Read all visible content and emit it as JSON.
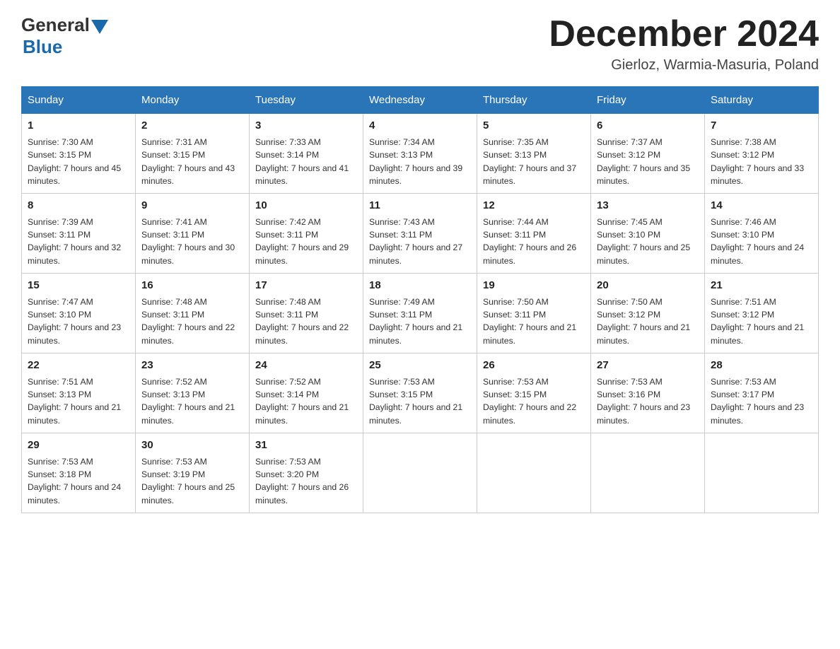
{
  "header": {
    "logo_general": "General",
    "logo_blue": "Blue",
    "month_title": "December 2024",
    "location": "Gierloz, Warmia-Masuria, Poland"
  },
  "days_of_week": [
    "Sunday",
    "Monday",
    "Tuesday",
    "Wednesday",
    "Thursday",
    "Friday",
    "Saturday"
  ],
  "weeks": [
    [
      {
        "day": "1",
        "sunrise": "7:30 AM",
        "sunset": "3:15 PM",
        "daylight": "7 hours and 45 minutes."
      },
      {
        "day": "2",
        "sunrise": "7:31 AM",
        "sunset": "3:15 PM",
        "daylight": "7 hours and 43 minutes."
      },
      {
        "day": "3",
        "sunrise": "7:33 AM",
        "sunset": "3:14 PM",
        "daylight": "7 hours and 41 minutes."
      },
      {
        "day": "4",
        "sunrise": "7:34 AM",
        "sunset": "3:13 PM",
        "daylight": "7 hours and 39 minutes."
      },
      {
        "day": "5",
        "sunrise": "7:35 AM",
        "sunset": "3:13 PM",
        "daylight": "7 hours and 37 minutes."
      },
      {
        "day": "6",
        "sunrise": "7:37 AM",
        "sunset": "3:12 PM",
        "daylight": "7 hours and 35 minutes."
      },
      {
        "day": "7",
        "sunrise": "7:38 AM",
        "sunset": "3:12 PM",
        "daylight": "7 hours and 33 minutes."
      }
    ],
    [
      {
        "day": "8",
        "sunrise": "7:39 AM",
        "sunset": "3:11 PM",
        "daylight": "7 hours and 32 minutes."
      },
      {
        "day": "9",
        "sunrise": "7:41 AM",
        "sunset": "3:11 PM",
        "daylight": "7 hours and 30 minutes."
      },
      {
        "day": "10",
        "sunrise": "7:42 AM",
        "sunset": "3:11 PM",
        "daylight": "7 hours and 29 minutes."
      },
      {
        "day": "11",
        "sunrise": "7:43 AM",
        "sunset": "3:11 PM",
        "daylight": "7 hours and 27 minutes."
      },
      {
        "day": "12",
        "sunrise": "7:44 AM",
        "sunset": "3:11 PM",
        "daylight": "7 hours and 26 minutes."
      },
      {
        "day": "13",
        "sunrise": "7:45 AM",
        "sunset": "3:10 PM",
        "daylight": "7 hours and 25 minutes."
      },
      {
        "day": "14",
        "sunrise": "7:46 AM",
        "sunset": "3:10 PM",
        "daylight": "7 hours and 24 minutes."
      }
    ],
    [
      {
        "day": "15",
        "sunrise": "7:47 AM",
        "sunset": "3:10 PM",
        "daylight": "7 hours and 23 minutes."
      },
      {
        "day": "16",
        "sunrise": "7:48 AM",
        "sunset": "3:11 PM",
        "daylight": "7 hours and 22 minutes."
      },
      {
        "day": "17",
        "sunrise": "7:48 AM",
        "sunset": "3:11 PM",
        "daylight": "7 hours and 22 minutes."
      },
      {
        "day": "18",
        "sunrise": "7:49 AM",
        "sunset": "3:11 PM",
        "daylight": "7 hours and 21 minutes."
      },
      {
        "day": "19",
        "sunrise": "7:50 AM",
        "sunset": "3:11 PM",
        "daylight": "7 hours and 21 minutes."
      },
      {
        "day": "20",
        "sunrise": "7:50 AM",
        "sunset": "3:12 PM",
        "daylight": "7 hours and 21 minutes."
      },
      {
        "day": "21",
        "sunrise": "7:51 AM",
        "sunset": "3:12 PM",
        "daylight": "7 hours and 21 minutes."
      }
    ],
    [
      {
        "day": "22",
        "sunrise": "7:51 AM",
        "sunset": "3:13 PM",
        "daylight": "7 hours and 21 minutes."
      },
      {
        "day": "23",
        "sunrise": "7:52 AM",
        "sunset": "3:13 PM",
        "daylight": "7 hours and 21 minutes."
      },
      {
        "day": "24",
        "sunrise": "7:52 AM",
        "sunset": "3:14 PM",
        "daylight": "7 hours and 21 minutes."
      },
      {
        "day": "25",
        "sunrise": "7:53 AM",
        "sunset": "3:15 PM",
        "daylight": "7 hours and 21 minutes."
      },
      {
        "day": "26",
        "sunrise": "7:53 AM",
        "sunset": "3:15 PM",
        "daylight": "7 hours and 22 minutes."
      },
      {
        "day": "27",
        "sunrise": "7:53 AM",
        "sunset": "3:16 PM",
        "daylight": "7 hours and 23 minutes."
      },
      {
        "day": "28",
        "sunrise": "7:53 AM",
        "sunset": "3:17 PM",
        "daylight": "7 hours and 23 minutes."
      }
    ],
    [
      {
        "day": "29",
        "sunrise": "7:53 AM",
        "sunset": "3:18 PM",
        "daylight": "7 hours and 24 minutes."
      },
      {
        "day": "30",
        "sunrise": "7:53 AM",
        "sunset": "3:19 PM",
        "daylight": "7 hours and 25 minutes."
      },
      {
        "day": "31",
        "sunrise": "7:53 AM",
        "sunset": "3:20 PM",
        "daylight": "7 hours and 26 minutes."
      },
      null,
      null,
      null,
      null
    ]
  ],
  "labels": {
    "sunrise_prefix": "Sunrise: ",
    "sunset_prefix": "Sunset: ",
    "daylight_prefix": "Daylight: "
  }
}
